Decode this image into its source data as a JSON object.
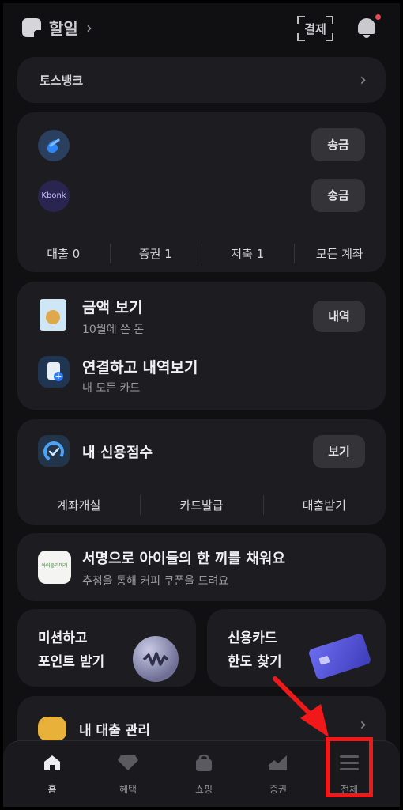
{
  "header": {
    "title": "할일",
    "pay_label": "결제"
  },
  "bank_row": {
    "label": "토스뱅크"
  },
  "accounts": {
    "rows": [
      {
        "bank": "toss",
        "action": "송금"
      },
      {
        "bank": "Kbonk",
        "action": "송금"
      }
    ],
    "tabs": [
      "대출 0",
      "증권 1",
      "저축 1",
      "모든 계좌"
    ]
  },
  "cards": {
    "spend_title": "금액 보기",
    "spend_sub": "10월에 쓴 돈",
    "spend_action": "내역",
    "connect_title": "연결하고 내역보기",
    "connect_sub": "내 모든 카드"
  },
  "credit": {
    "title": "내 신용점수",
    "action": "보기",
    "tabs": [
      "계좌개설",
      "카드발급",
      "대출받기"
    ]
  },
  "promo": {
    "title": "서명으로 아이들의 한 끼를 채워요",
    "sub": "추첨을 통해 커피 쿠폰을 드려요",
    "logo_text": "아이들과미래"
  },
  "half_cards": [
    {
      "line1": "미션하고",
      "line2": "포인트 받기"
    },
    {
      "line1": "신용카드",
      "line2": "한도 찾기"
    }
  ],
  "loan": {
    "title": "내 대출 관리"
  },
  "nav": {
    "items": [
      {
        "label": "홈",
        "icon": "home-icon"
      },
      {
        "label": "혜택",
        "icon": "diamond-icon"
      },
      {
        "label": "쇼핑",
        "icon": "shopping-bag-icon"
      },
      {
        "label": "증권",
        "icon": "stock-chart-icon"
      },
      {
        "label": "전체",
        "icon": "menu-icon"
      }
    ]
  },
  "colors": {
    "highlight": "#f01818",
    "background": "#101013",
    "card": "#1d1d21"
  }
}
